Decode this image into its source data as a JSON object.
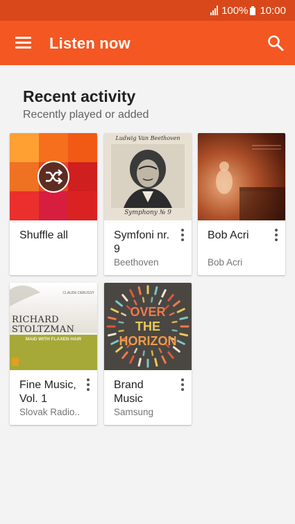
{
  "status_bar": {
    "battery": "100%",
    "time": "10:00"
  },
  "app_bar": {
    "title": "Listen now"
  },
  "section": {
    "title": "Recent activity",
    "subtitle": "Recently played or added"
  },
  "cards": [
    {
      "title": "Shuffle all",
      "subtitle": "",
      "art": "shuffle"
    },
    {
      "title": "Symfoni nr. 9",
      "subtitle": "Beethoven",
      "art": "beethoven",
      "art_text": [
        "Ludwig Van Beethoven",
        "Symphony № 9"
      ]
    },
    {
      "title": "Bob Acri",
      "subtitle": "Bob Acri",
      "art": "piano"
    },
    {
      "title": "Fine Music, Vol. 1",
      "subtitle": "Slovak Radio..",
      "art": "stoltzman",
      "art_text": [
        "CLAUDE DEBUSSY",
        "RICHARD",
        "STOLTZMAN",
        "MAID WITH FLAXEN HAIR"
      ]
    },
    {
      "title": "Brand Music",
      "subtitle": "Samsung",
      "art": "horizon",
      "art_text": [
        "OVER",
        "THE",
        "HORIZON"
      ]
    }
  ],
  "colors": {
    "status_bar": "#d9481a",
    "app_bar": "#f45722",
    "background": "#f3f3f3",
    "shuffle_tiles": [
      "#ffa033",
      "#f66f1c",
      "#f05a15",
      "#ef7122",
      "#e7452a",
      "#cf1f1f",
      "#eb2f2c",
      "#d81e3e",
      "#db2222"
    ]
  },
  "icons": {
    "menu": "menu-icon",
    "search": "search-icon",
    "shuffle": "shuffle-icon",
    "more": "more-vert-icon"
  }
}
